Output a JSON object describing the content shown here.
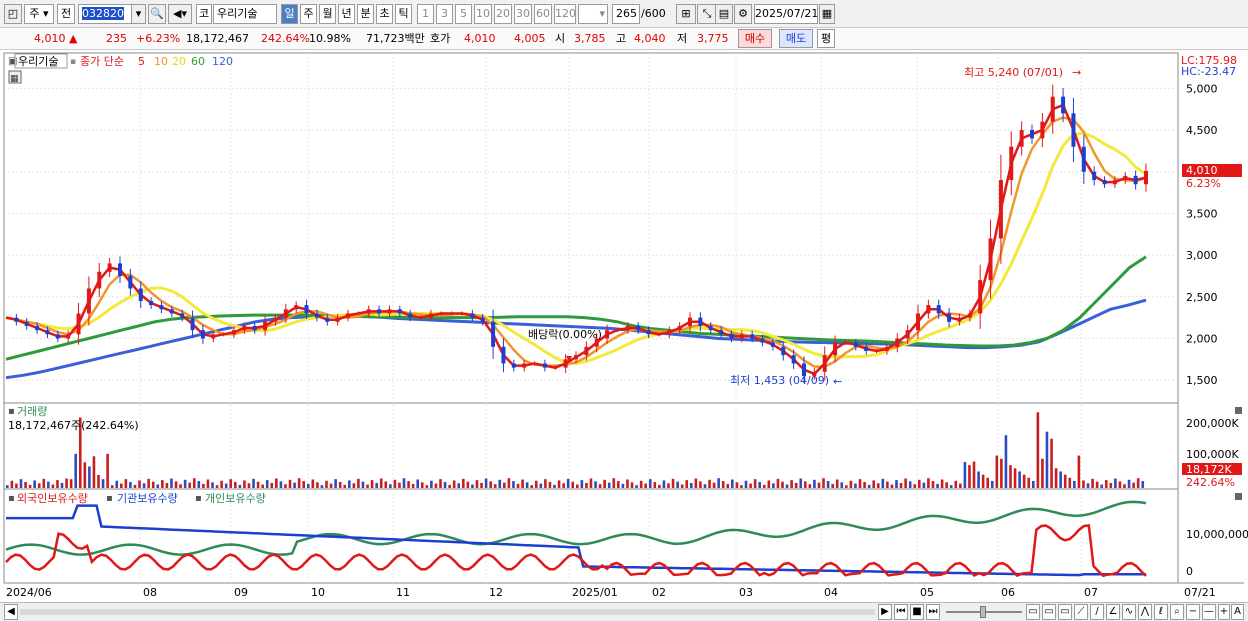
{
  "toolbar": {
    "market": "주",
    "prev": "전",
    "code": "032820",
    "market_tag": "코",
    "name": "우리기술",
    "periods": [
      "일",
      "주",
      "월",
      "년",
      "분",
      "초",
      "틱"
    ],
    "active_period": "일",
    "intervals": [
      "1",
      "3",
      "5",
      "10",
      "20",
      "30",
      "60",
      "120"
    ],
    "count": "265",
    "count_max": "/600",
    "date": "2025/07/21"
  },
  "quote": {
    "price": "4,010",
    "change": "235",
    "change_pct": "+6.23%",
    "volume": "18,172,467",
    "volume_ratio": "242.64%",
    "turnover": "10.98%",
    "amount": "71,723백만",
    "bid_label": "호가",
    "bid_price": "4,010",
    "bid_price2": "4,005",
    "open_label": "시",
    "open": "3,785",
    "high_label": "고",
    "high": "4,040",
    "low_label": "저",
    "low": "3,775",
    "buy": "매수",
    "sell": "매도",
    "eval": "평"
  },
  "chart_legend": {
    "stock": "우리기술",
    "close_label": "종가 단순",
    "ma": [
      "5",
      "10",
      "20",
      "60",
      "120"
    ],
    "lc": "LC:175.98",
    "hc": "HC:-23.47",
    "price_tag": "4,010",
    "pct_tag": "6.23%",
    "high_note": "최고 5,240 (07/01)",
    "low_note": "최저 1,453 (04/09)",
    "dividend_note": "배당락(0.00%)"
  },
  "volume_panel": {
    "title": "거래량",
    "value": "18,172,467주(242.64%)",
    "ticks": [
      "200,000K",
      "100,000K"
    ],
    "tag": "18,172K",
    "tag2": "242.64%"
  },
  "holdings_panel": {
    "foreign": "외국인보유수량",
    "institution": "기관보유수량",
    "individual": "개인보유수량",
    "ticks": [
      "10,000,000",
      "0"
    ]
  },
  "x_labels": [
    "2024/06",
    "08",
    "09",
    "10",
    "11",
    "12",
    "2025/01",
    "02",
    "03",
    "04",
    "05",
    "06",
    "07",
    "07/21"
  ],
  "chart_data": {
    "type": "line",
    "price_ticks": [
      5000,
      4500,
      4000,
      3500,
      3000,
      2500,
      2000,
      1500
    ],
    "ylim": [
      1250,
      5400
    ],
    "close": [
      2250,
      2200,
      2150,
      2100,
      2050,
      2000,
      2050,
      2300,
      2600,
      2800,
      2900,
      2750,
      2600,
      2450,
      2400,
      2350,
      2300,
      2250,
      2100,
      2000,
      2050,
      2050,
      2100,
      2150,
      2100,
      2200,
      2250,
      2350,
      2400,
      2300,
      2250,
      2200,
      2250,
      2300,
      2300,
      2350,
      2300,
      2350,
      2300,
      2250,
      2250,
      2300,
      2300,
      2300,
      2300,
      2250,
      2200,
      1900,
      1700,
      1650,
      1700,
      1700,
      1650,
      1650,
      1750,
      1800,
      1900,
      2000,
      2100,
      2100,
      2150,
      2100,
      2050,
      2050,
      2100,
      2150,
      2250,
      2150,
      2100,
      2050,
      2000,
      2050,
      2000,
      1950,
      1900,
      1800,
      1700,
      1550,
      1600,
      1800,
      1950,
      1950,
      1900,
      1850,
      1850,
      1900,
      2000,
      2100,
      2300,
      2400,
      2300,
      2200,
      2250,
      2300,
      2700,
      3200,
      3900,
      4300,
      4500,
      4400,
      4600,
      4900,
      4700,
      4300,
      4000,
      3900,
      3850,
      3900,
      3950,
      3850,
      4010
    ],
    "ma60": [
      1750,
      1800,
      1850,
      1900,
      1950,
      2000,
      2050,
      2100,
      2150,
      2200,
      2230,
      2250,
      2260,
      2270,
      2275,
      2280,
      2280,
      2280,
      2280,
      2275,
      2270,
      2265,
      2260,
      2260,
      2255,
      2250,
      2250,
      2250,
      2250,
      2250,
      2255,
      2260,
      2260,
      2260,
      2260,
      2250,
      2230,
      2200,
      2150,
      2120,
      2100,
      2080,
      2060,
      2050,
      2040,
      2030,
      2020,
      2010,
      2000,
      1990,
      1980,
      1975,
      1970,
      1960,
      1950,
      1940,
      1930,
      1920,
      1915,
      1910,
      1910,
      1920,
      1950,
      2000,
      2100,
      2250,
      2450,
      2650,
      2850,
      2980
    ],
    "ma120": [
      1530,
      1560,
      1600,
      1650,
      1700,
      1750,
      1800,
      1850,
      1900,
      1950,
      2000,
      2050,
      2100,
      2150,
      2200,
      2230,
      2250,
      2260,
      2265,
      2270,
      2265,
      2255,
      2240,
      2230,
      2220,
      2210,
      2200,
      2190,
      2180,
      2170,
      2160,
      2150,
      2140,
      2130,
      2120,
      2100,
      2080,
      2060,
      2040,
      2020,
      2000,
      1990,
      1980,
      1970,
      1960,
      1955,
      1950,
      1945,
      1940,
      1935,
      1930,
      1920,
      1910,
      1900,
      1890,
      1890,
      1900,
      1920,
      1960,
      2050,
      2150,
      2250,
      2350,
      2400,
      2460
    ],
    "volume_ticks": [
      200000,
      100000
    ],
    "volume_ylim": [
      0,
      230000
    ],
    "holdings_ticks": [
      10000000,
      0
    ],
    "holdings_ylim": [
      -1000000,
      20000000
    ]
  }
}
